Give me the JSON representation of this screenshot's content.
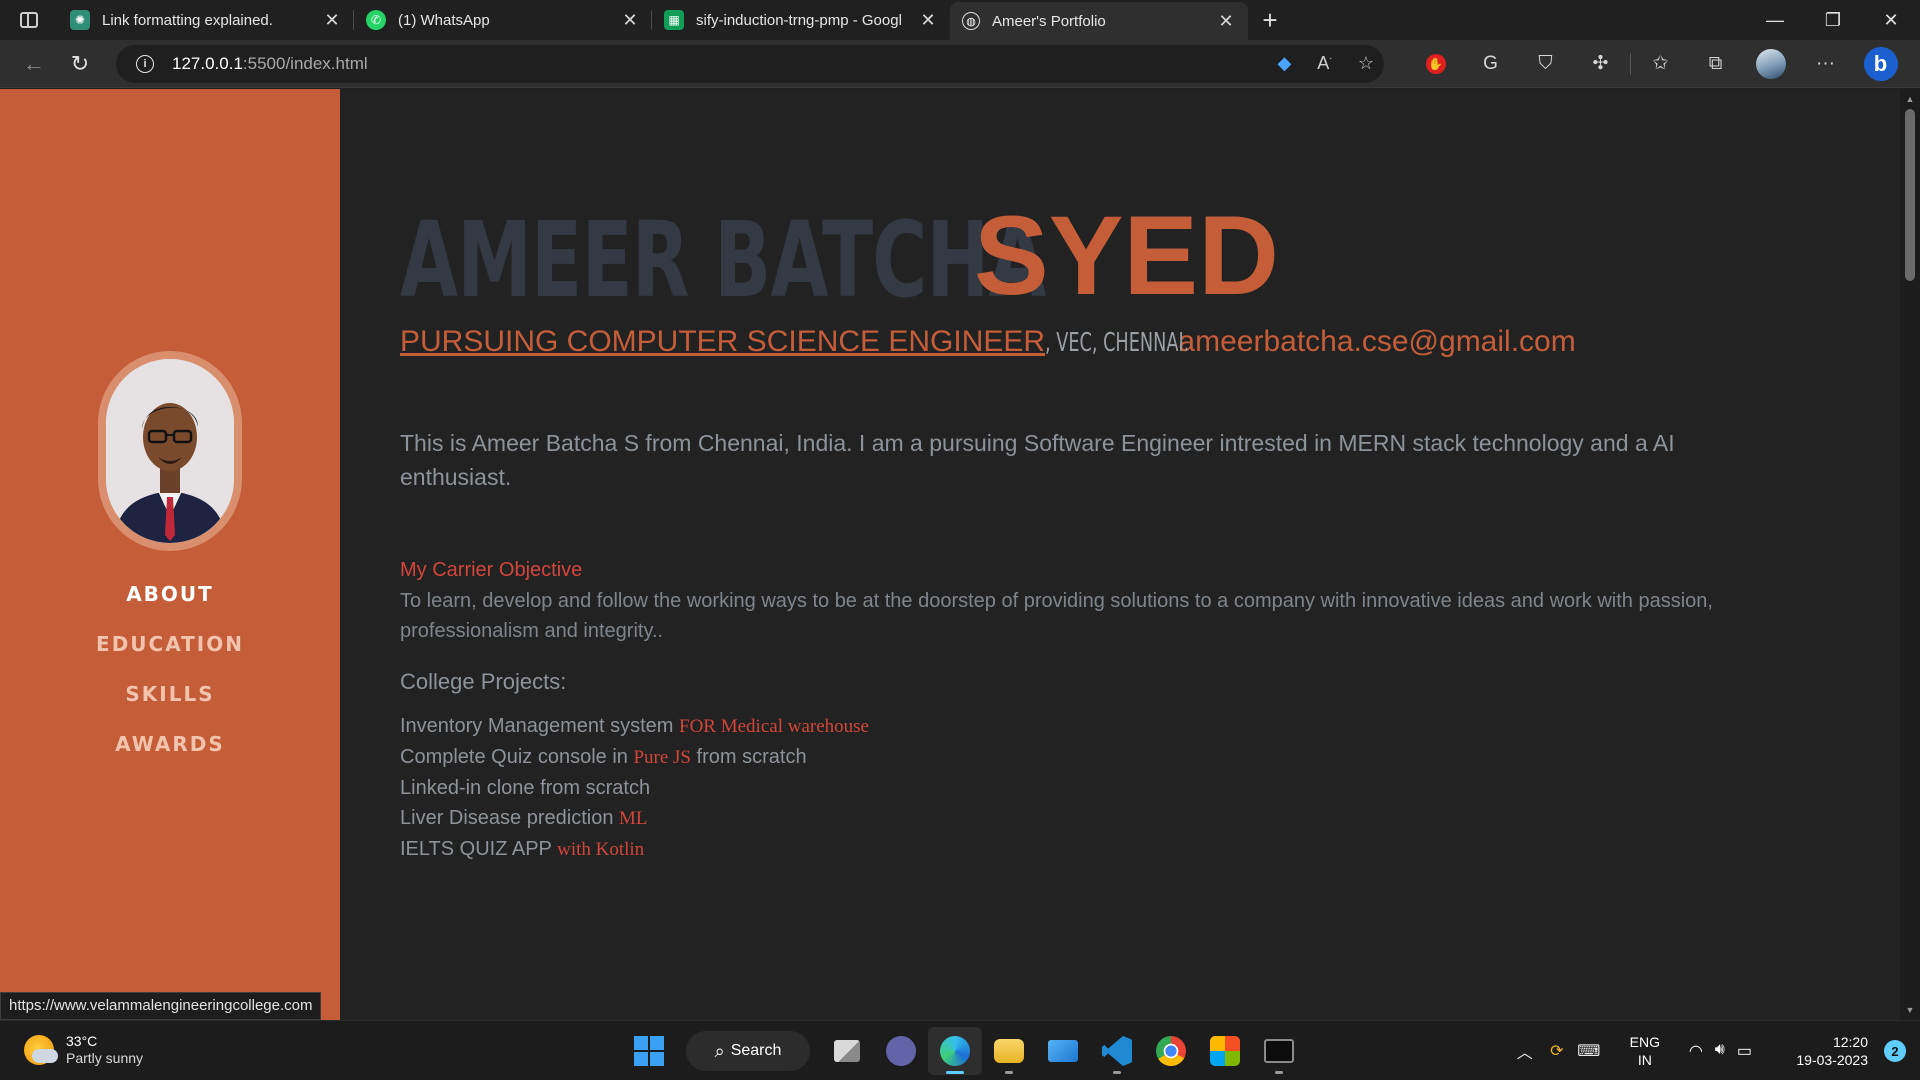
{
  "browser": {
    "tabs": [
      {
        "title": "Link formatting explained.",
        "favicon": "chatgpt-icon",
        "color": "#2f8f76",
        "active": false
      },
      {
        "title": "(1) WhatsApp",
        "favicon": "whatsapp-icon",
        "color": "#25d366",
        "active": false
      },
      {
        "title": "sify-induction-trng-pmp - Googl",
        "favicon": "sheets-icon",
        "color": "#0f9d58",
        "active": false
      },
      {
        "title": "Ameer's Portfolio",
        "favicon": "globe-icon",
        "color": "#303030",
        "active": true
      }
    ],
    "address": {
      "host": "127.0.0.1",
      "path": ":5500/index.html"
    }
  },
  "theme": {
    "accent": "#c45d38",
    "background": "#222222",
    "name_dark": "#343a44",
    "highlight_red": "#d2453b",
    "body_text": "#8d939a"
  },
  "sidebar": {
    "nav": [
      {
        "label": "ABOUT",
        "active": true
      },
      {
        "label": "EDUCATION",
        "active": false
      },
      {
        "label": "SKILLS",
        "active": false
      },
      {
        "label": "AWARDS",
        "active": false
      }
    ]
  },
  "about": {
    "first_name": "AMEER BATCHA",
    "last_name": "SYED",
    "role": "Pursuing Computer Science Engineer",
    "college": ", VEC, CHENNAI.",
    "email": "ameerbatcha.cse@gmail.com",
    "lead": "This is Ameer Batcha S from Chennai, India. I am a pursuing Software Engineer intrested in MERN stack technology and a AI enthusiast.",
    "objective_title": "My Carrier Objective",
    "objective_text": "To learn, develop and follow the working ways to be at the doorstep of providing solutions to a company with innovative ideas and work with passion, professionalism and integrity..",
    "projects_title": "College Projects:",
    "projects": [
      {
        "pre": "Inventory Management system ",
        "hl": "FOR Medical warehouse",
        "post": ""
      },
      {
        "pre": "Complete Quiz console in ",
        "hl": "Pure JS",
        "post": " from scratch"
      },
      {
        "pre": "Linked-in clone from scratch",
        "hl": "",
        "post": ""
      },
      {
        "pre": "Liver Disease prediction ",
        "hl": "ML",
        "post": ""
      },
      {
        "pre": "IELTS QUIZ APP ",
        "hl": "with Kotlin",
        "post": ""
      }
    ]
  },
  "status_link": "https://www.velammalengineeringcollege.com",
  "taskbar": {
    "weather_temp": "33°C",
    "weather_cond": "Partly sunny",
    "search_label": "Search",
    "lang_line1": "ENG",
    "lang_line2": "IN",
    "time": "12:20",
    "date": "19-03-2023",
    "notifications": "2"
  }
}
